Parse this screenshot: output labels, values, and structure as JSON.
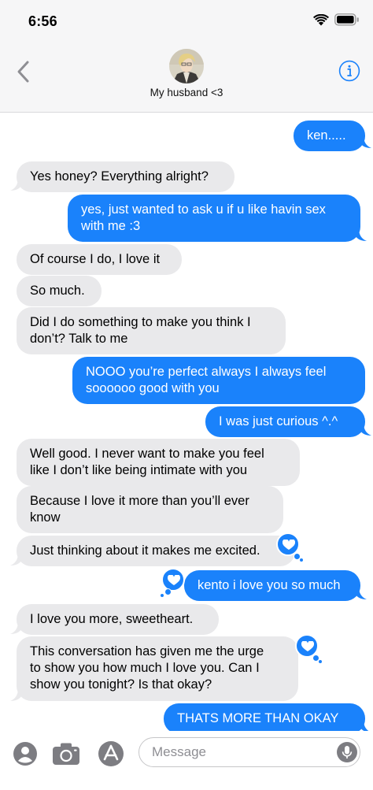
{
  "status": {
    "time": "6:56"
  },
  "header": {
    "contact_name": "My husband <3",
    "avatar_alt": "contact-avatar"
  },
  "colors": {
    "outgoing": "#1a82fb",
    "incoming": "#e9e9eb",
    "accent": "#1a82fb"
  },
  "messages": [
    {
      "side": "out",
      "text": "ken....."
    },
    {
      "side": "in",
      "text": "Yes honey? Everything alright?"
    },
    {
      "side": "out",
      "text": "yes, just wanted to ask u if u like havin sex\nwith me :3"
    },
    {
      "side": "in",
      "text": "Of course I do, I love it"
    },
    {
      "side": "in",
      "text": "So much."
    },
    {
      "side": "in",
      "text": "Did I do something to make you think I\ndon’t? Talk to me"
    },
    {
      "side": "out",
      "text": "NOOO you’re perfect always I always feel\nsoooooo good with you"
    },
    {
      "side": "out",
      "text": "I was just curious ^.^"
    },
    {
      "side": "in",
      "text": "Well good. I never want to make you feel\nlike I don’t like being intimate with you"
    },
    {
      "side": "in",
      "text": "Because I love it more than you’ll ever\nknow"
    },
    {
      "side": "in",
      "text": "Just thinking about it makes me excited.",
      "reaction": "heart"
    },
    {
      "side": "out",
      "text": "kento i love you so much",
      "reaction": "heart"
    },
    {
      "side": "in",
      "text": "I love you more, sweetheart."
    },
    {
      "side": "in",
      "text": "This conversation has given me the urge\nto show you how much I love you. Can I\nshow you tonight? Is that okay?",
      "reaction": "heart"
    },
    {
      "side": "out",
      "text": "THATS MORE THAN OKAY"
    }
  ],
  "composer": {
    "placeholder": "Message"
  }
}
